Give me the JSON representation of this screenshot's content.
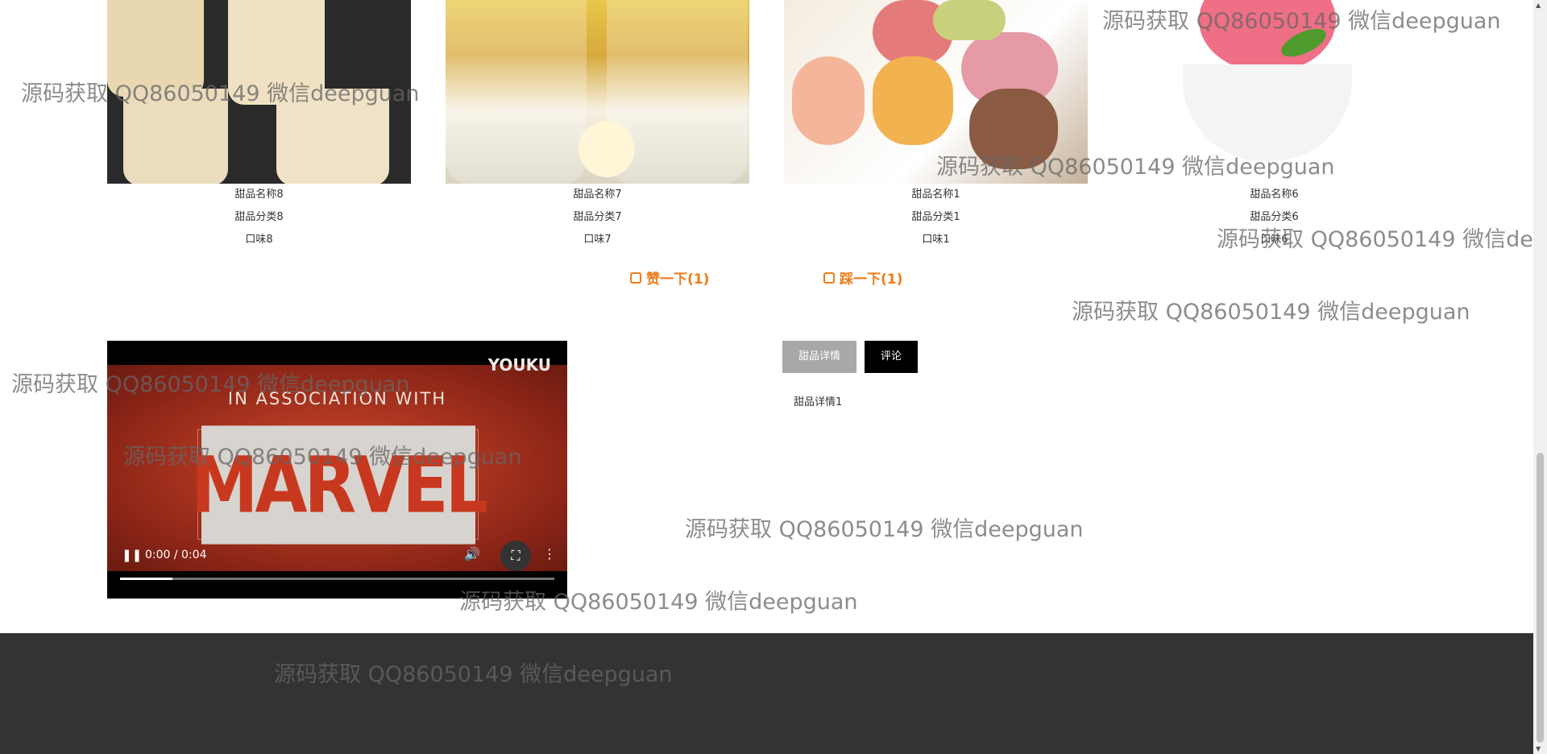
{
  "products": [
    {
      "name": "甜品名称8",
      "category": "甜品分类8",
      "flavor": "口味8"
    },
    {
      "name": "甜品名称7",
      "category": "甜品分类7",
      "flavor": "口味7"
    },
    {
      "name": "甜品名称1",
      "category": "甜品分类1",
      "flavor": "口味1"
    },
    {
      "name": "甜品名称6",
      "category": "甜品分类6",
      "flavor": "口味6"
    }
  ],
  "votes": {
    "like_label": "赞一下(1)",
    "dislike_label": "踩一下(1)"
  },
  "video": {
    "brand": "YOUKU",
    "association": "IN ASSOCIATION WITH",
    "logo_text": "MARVEL",
    "time": "0:00 / 0:04",
    "progress": 0.12
  },
  "tabs": {
    "detail_label": "甜品详情",
    "comment_label": "评论"
  },
  "detail_text": "甜品详情1",
  "watermark": "源码获取 QQ86050149 微信deepguan",
  "colors": {
    "accent": "#ee7c1a",
    "footer": "#333333",
    "tab_inactive": "#a8a8a8",
    "tab_active": "#000000"
  }
}
